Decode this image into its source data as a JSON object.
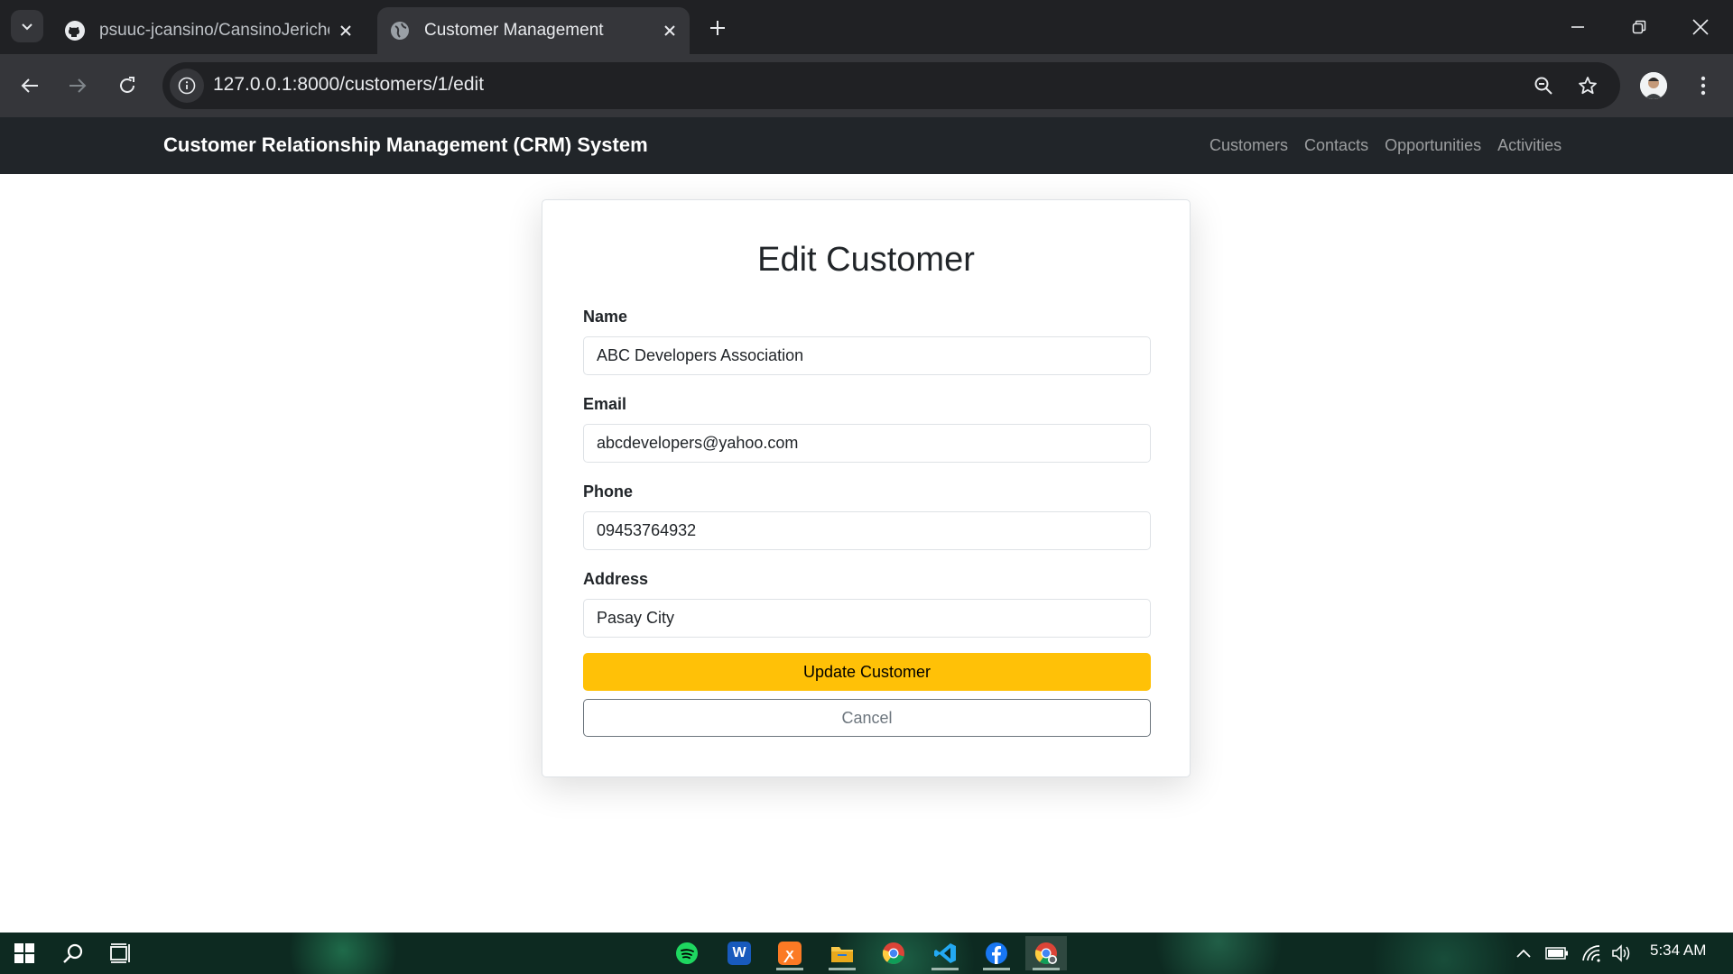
{
  "browser": {
    "tabs": [
      {
        "title": "psuuc-jcansino/CansinoJericho",
        "icon": "github-icon"
      },
      {
        "title": "Customer Management",
        "icon": "globe-icon"
      }
    ],
    "url": "127.0.0.1:8000/customers/1/edit"
  },
  "app": {
    "brand": "Customer Relationship Management (CRM) System",
    "nav": [
      "Customers",
      "Contacts",
      "Opportunities",
      "Activities"
    ]
  },
  "form": {
    "heading": "Edit Customer",
    "fields": [
      {
        "label": "Name",
        "value": "ABC Developers Association"
      },
      {
        "label": "Email",
        "value": "abcdevelopers@yahoo.com"
      },
      {
        "label": "Phone",
        "value": "09453764932"
      },
      {
        "label": "Address",
        "value": "Pasay City"
      }
    ],
    "update_label": "Update Customer",
    "cancel_label": "Cancel"
  },
  "taskbar": {
    "apps": [
      "spotify-icon",
      "word-icon",
      "xampp-icon",
      "file-explorer-icon",
      "chrome-icon",
      "vscode-icon",
      "facebook-icon",
      "chrome-active-icon"
    ],
    "clock": "5:34 AM"
  },
  "colors": {
    "navbar_bg": "#212529",
    "update_button": "#ffc107",
    "cancel_border": "#6c757d"
  }
}
